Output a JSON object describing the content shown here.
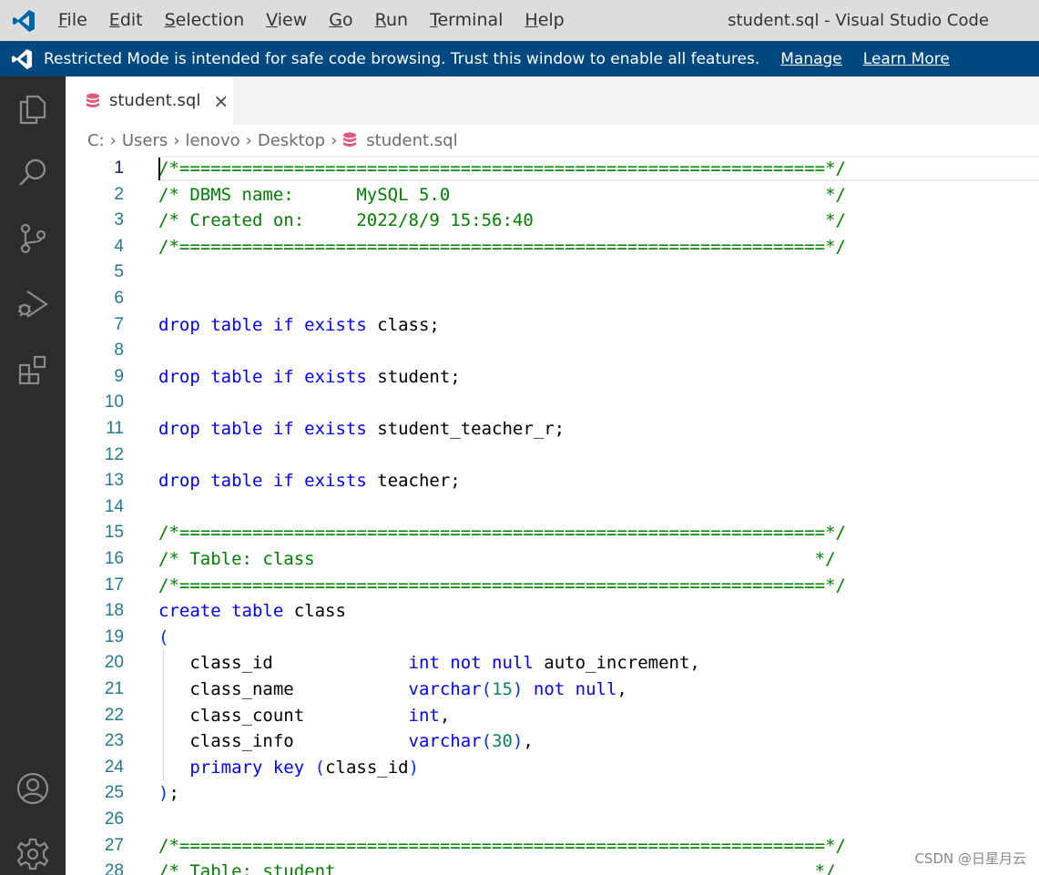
{
  "titlebar": {
    "menu": [
      {
        "accel": "F",
        "rest": "ile"
      },
      {
        "accel": "E",
        "rest": "dit"
      },
      {
        "accel": "S",
        "rest": "election"
      },
      {
        "accel": "V",
        "rest": "iew"
      },
      {
        "accel": "G",
        "rest": "o"
      },
      {
        "accel": "R",
        "rest": "un"
      },
      {
        "accel": "T",
        "rest": "erminal"
      },
      {
        "accel": "H",
        "rest": "elp"
      }
    ],
    "window_title": "student.sql - Visual Studio Code"
  },
  "banner": {
    "text": "Restricted Mode is intended for safe code browsing. Trust this window to enable all features.",
    "manage": "Manage",
    "learn_more": "Learn More"
  },
  "activitybar": {
    "icons": [
      "explorer-icon",
      "search-icon",
      "source-control-icon",
      "run-debug-icon",
      "extensions-icon",
      "account-icon",
      "settings-gear-icon"
    ]
  },
  "tab": {
    "label": "student.sql",
    "close": "×"
  },
  "breadcrumb": {
    "parts": [
      "C:",
      "Users",
      "lenovo",
      "Desktop"
    ],
    "file": "student.sql",
    "sep": "›"
  },
  "editor": {
    "active_line": 1,
    "lines": [
      {
        "n": "1",
        "tokens": [
          [
            "com",
            "/*==============================================================*/"
          ]
        ]
      },
      {
        "n": "2",
        "tokens": [
          [
            "com",
            "/* DBMS name:      MySQL 5.0                                    */"
          ]
        ]
      },
      {
        "n": "3",
        "tokens": [
          [
            "com",
            "/* Created on:     2022/8/9 15:56:40                            */"
          ]
        ]
      },
      {
        "n": "4",
        "tokens": [
          [
            "com",
            "/*==============================================================*/"
          ]
        ]
      },
      {
        "n": "5",
        "tokens": []
      },
      {
        "n": "6",
        "tokens": []
      },
      {
        "n": "7",
        "tokens": [
          [
            "kw",
            "drop table if exists"
          ],
          [
            "txt",
            " class;"
          ]
        ]
      },
      {
        "n": "8",
        "tokens": []
      },
      {
        "n": "9",
        "tokens": [
          [
            "kw",
            "drop table if exists"
          ],
          [
            "txt",
            " student;"
          ]
        ]
      },
      {
        "n": "10",
        "tokens": []
      },
      {
        "n": "11",
        "tokens": [
          [
            "kw",
            "drop table if exists"
          ],
          [
            "txt",
            " student_teacher_r;"
          ]
        ]
      },
      {
        "n": "12",
        "tokens": []
      },
      {
        "n": "13",
        "tokens": [
          [
            "kw",
            "drop table if exists"
          ],
          [
            "txt",
            " teacher;"
          ]
        ]
      },
      {
        "n": "14",
        "tokens": []
      },
      {
        "n": "15",
        "tokens": [
          [
            "com",
            "/*==============================================================*/"
          ]
        ]
      },
      {
        "n": "16",
        "tokens": [
          [
            "com",
            "/* Table: class                                                */"
          ]
        ]
      },
      {
        "n": "17",
        "tokens": [
          [
            "com",
            "/*==============================================================*/"
          ]
        ]
      },
      {
        "n": "18",
        "tokens": [
          [
            "kw",
            "create table"
          ],
          [
            "txt",
            " class"
          ]
        ]
      },
      {
        "n": "19",
        "tokens": [
          [
            "par",
            "("
          ]
        ]
      },
      {
        "n": "20",
        "tokens": [
          [
            "txt",
            "   class_id             "
          ],
          [
            "kw",
            "int not null"
          ],
          [
            "txt",
            " auto_increment,"
          ]
        ]
      },
      {
        "n": "21",
        "tokens": [
          [
            "txt",
            "   class_name           "
          ],
          [
            "kw",
            "varchar"
          ],
          [
            "par",
            "("
          ],
          [
            "num",
            "15"
          ],
          [
            "par",
            ")"
          ],
          [
            "txt",
            " "
          ],
          [
            "kw",
            "not null"
          ],
          [
            "txt",
            ","
          ]
        ]
      },
      {
        "n": "22",
        "tokens": [
          [
            "txt",
            "   class_count          "
          ],
          [
            "kw",
            "int"
          ],
          [
            "txt",
            ","
          ]
        ]
      },
      {
        "n": "23",
        "tokens": [
          [
            "txt",
            "   class_info           "
          ],
          [
            "kw",
            "varchar"
          ],
          [
            "par",
            "("
          ],
          [
            "num",
            "30"
          ],
          [
            "par",
            ")"
          ],
          [
            "txt",
            ","
          ]
        ]
      },
      {
        "n": "24",
        "tokens": [
          [
            "txt",
            "   "
          ],
          [
            "kw",
            "primary key"
          ],
          [
            "txt",
            " "
          ],
          [
            "par",
            "("
          ],
          [
            "txt",
            "class_id"
          ],
          [
            "par",
            ")"
          ]
        ]
      },
      {
        "n": "25",
        "tokens": [
          [
            "par",
            ")"
          ],
          [
            "txt",
            ";"
          ]
        ]
      },
      {
        "n": "26",
        "tokens": []
      },
      {
        "n": "27",
        "tokens": [
          [
            "com",
            "/*==============================================================*/"
          ]
        ]
      },
      {
        "n": "28",
        "tokens": [
          [
            "com",
            "/* Table: student                                              */"
          ]
        ]
      }
    ]
  },
  "watermark": "CSDN @日星月云",
  "colors": {
    "banner_bg": "#004880",
    "activity_bg": "#2c2c2c",
    "vscode_blue": "#0065a9",
    "sql_icon": "#e05a7b"
  }
}
